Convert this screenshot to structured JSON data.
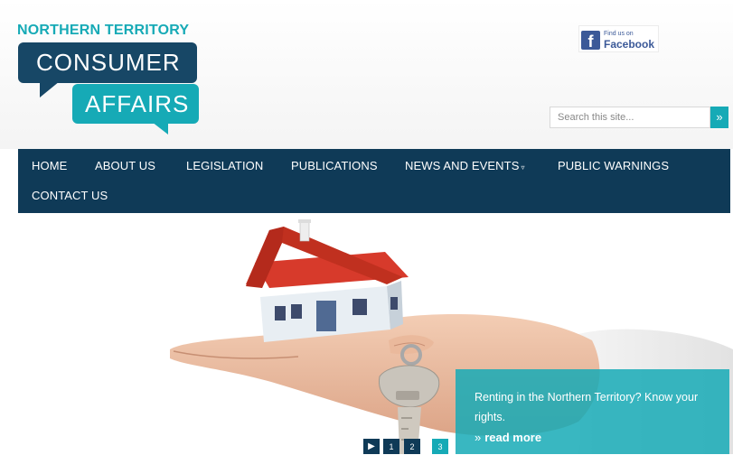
{
  "logo": {
    "top_text": "NORTHERN TERRITORY",
    "line1": "CONSUMER",
    "line2": "AFFAIRS",
    "colors": {
      "navy": "#174766",
      "teal": "#16aab6"
    }
  },
  "facebook": {
    "small_text": "Find us on",
    "big_text": "Facebook",
    "icon": "facebook-icon"
  },
  "search": {
    "placeholder": "Search this site...",
    "button_glyph": "»"
  },
  "nav": {
    "items": [
      {
        "label": "HOME"
      },
      {
        "label": "ABOUT US"
      },
      {
        "label": "LEGISLATION"
      },
      {
        "label": "PUBLICATIONS"
      },
      {
        "label": "NEWS AND EVENTS",
        "has_dropdown": true
      },
      {
        "label": "PUBLIC WARNINGS"
      },
      {
        "label": "CONTACT US"
      }
    ],
    "background": "#0f3a57"
  },
  "hero": {
    "callout_text": "Renting in the Northern Territory? Know your rights.",
    "link_label": "read more",
    "link_prefix": "»"
  },
  "pager": {
    "play": "▶",
    "pages": [
      "1",
      "2",
      "3"
    ],
    "active": 3
  }
}
